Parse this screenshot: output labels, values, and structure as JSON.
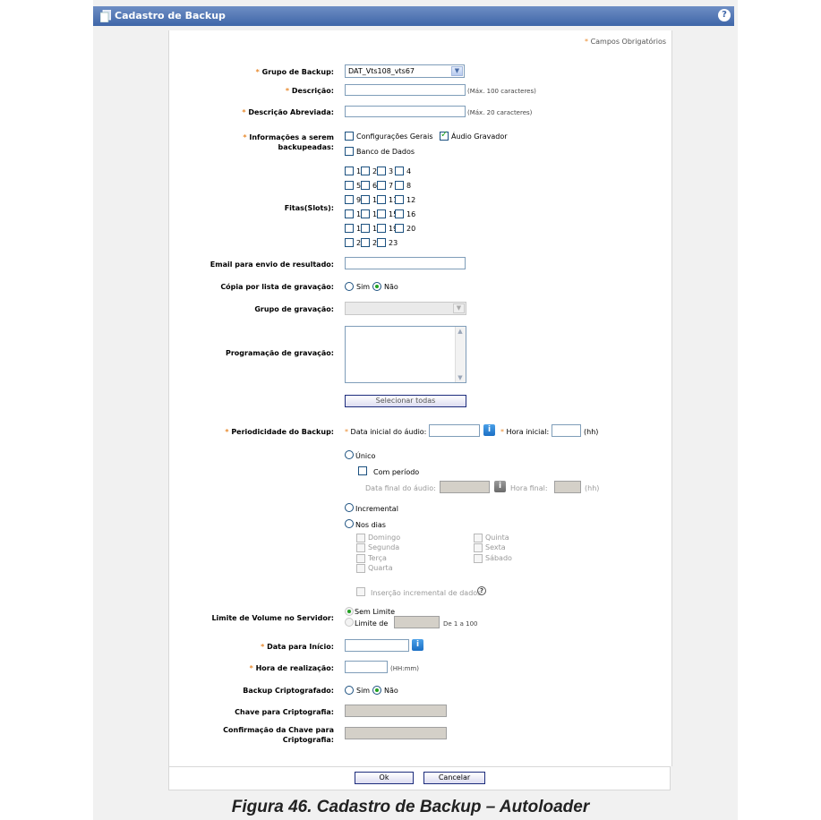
{
  "window": {
    "title": "Cadastro de Backup",
    "help": "?"
  },
  "required_note": "Campos Obrigatórios",
  "required_mark": "*",
  "fields": {
    "grupo_backup": {
      "label": "Grupo de Backup:",
      "value": "DAT_Vts108_vts67"
    },
    "descricao": {
      "label": "Descrição:",
      "hint": "(Máx. 100 caracteres)"
    },
    "descricao_abreviada": {
      "label": "Descrição Abreviada:",
      "hint": "(Máx. 20 caracteres)"
    },
    "informacoes": {
      "label_line1": "Informações a serem",
      "label_line2": "backupeadas:",
      "options": {
        "config_gerais": "Configurações Gerais",
        "audio_gravador": "Áudio Gravador",
        "banco_dados": "Banco de Dados"
      }
    },
    "fitas": {
      "label": "Fitas(Slots):",
      "slots": [
        "1",
        "2",
        "3",
        "4",
        "5",
        "6",
        "7",
        "8",
        "9",
        "10",
        "11",
        "12",
        "13",
        "14",
        "15",
        "16",
        "17",
        "18",
        "19",
        "20",
        "21",
        "22",
        "23"
      ]
    },
    "email": {
      "label": "Email para envio de resultado:"
    },
    "copia_lista": {
      "label": "Cópia por lista de gravação:",
      "sim": "Sim",
      "nao": "Não",
      "selected": "Não"
    },
    "grupo_gravacao": {
      "label": "Grupo de gravação:"
    },
    "programacao_gravacao": {
      "label": "Programação de gravação:",
      "select_all": "Selecionar todas"
    },
    "periodicidade": {
      "label": "Periodicidade do Backup:",
      "data_inicial": "Data inicial do áudio:",
      "hora_inicial": "Hora inicial:",
      "hh": "(hh)",
      "unico": "Único",
      "com_periodo": "Com período",
      "data_final": "Data final do áudio:",
      "hora_final": "Hora final:",
      "incremental": "Incremental",
      "nos_dias": "Nos dias",
      "dias": {
        "domingo": "Domingo",
        "segunda": "Segunda",
        "terca": "Terça",
        "quarta": "Quarta",
        "quinta": "Quinta",
        "sexta": "Sexta",
        "sabado": "Sábado"
      },
      "insercao": "Inserção incremental de dados"
    },
    "limite_volume": {
      "label": "Limite de Volume no Servidor:",
      "sem_limite": "Sem Limite",
      "limite_de": "Limite de",
      "range": "De 1 a 100"
    },
    "data_inicio": {
      "label": "Data para Início:"
    },
    "hora_realizacao": {
      "label": "Hora de realização:",
      "hint": "(HH:mm)"
    },
    "backup_cripto": {
      "label": "Backup Criptografado:",
      "sim": "Sim",
      "nao": "Não",
      "selected": "Não"
    },
    "chave_cripto": {
      "label": "Chave para Criptografia:"
    },
    "confirmacao_chave": {
      "label_line1": "Confirmação da Chave para",
      "label_line2": "Criptografia:"
    }
  },
  "buttons": {
    "ok": "Ok",
    "cancelar": "Cancelar"
  },
  "caption": "Figura 46. Cadastro de Backup – Autoloader"
}
